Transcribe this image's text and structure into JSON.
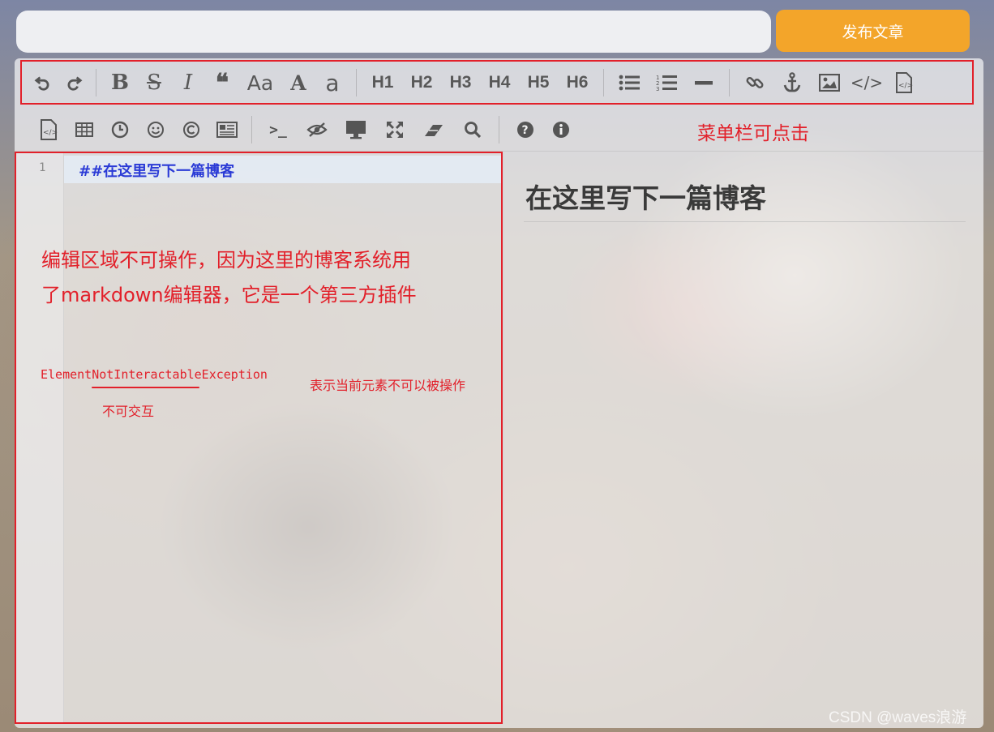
{
  "header": {
    "title_placeholder": "",
    "publish_label": "发布文章"
  },
  "toolbar_row1": [
    {
      "name": "undo-icon"
    },
    {
      "name": "redo-icon"
    },
    {
      "name": "bold-icon",
      "glyph": "B"
    },
    {
      "name": "strikethrough-icon",
      "glyph": "S"
    },
    {
      "name": "italic-icon",
      "glyph": "I"
    },
    {
      "name": "quote-icon",
      "glyph": "❝"
    },
    {
      "name": "uppercase-icon",
      "glyph": "Aa"
    },
    {
      "name": "ucfirst-icon",
      "glyph": "A"
    },
    {
      "name": "lowercase-icon",
      "glyph": "a"
    },
    {
      "name": "h1-button",
      "glyph": "H1"
    },
    {
      "name": "h2-button",
      "glyph": "H2"
    },
    {
      "name": "h3-button",
      "glyph": "H3"
    },
    {
      "name": "h4-button",
      "glyph": "H4"
    },
    {
      "name": "h5-button",
      "glyph": "H5"
    },
    {
      "name": "h6-button",
      "glyph": "H6"
    },
    {
      "name": "unordered-list-icon"
    },
    {
      "name": "ordered-list-icon"
    },
    {
      "name": "horizontal-rule-icon"
    },
    {
      "name": "link-icon"
    },
    {
      "name": "anchor-icon"
    },
    {
      "name": "image-icon"
    },
    {
      "name": "code-icon"
    },
    {
      "name": "code-block-icon"
    }
  ],
  "toolbar_row2": [
    {
      "name": "preformatted-text-icon"
    },
    {
      "name": "table-icon"
    },
    {
      "name": "datetime-icon"
    },
    {
      "name": "emoji-icon"
    },
    {
      "name": "html-entities-icon"
    },
    {
      "name": "pagebreak-icon"
    },
    {
      "name": "terminal-icon"
    },
    {
      "name": "watch-toggle-icon"
    },
    {
      "name": "preview-icon"
    },
    {
      "name": "fullscreen-icon"
    },
    {
      "name": "clear-icon"
    },
    {
      "name": "search-icon"
    },
    {
      "name": "help-icon"
    },
    {
      "name": "info-icon"
    }
  ],
  "editor": {
    "line_number": "1",
    "code_text": "##在这里写下一篇博客"
  },
  "preview": {
    "heading": "在这里写下一篇博客"
  },
  "annotations": {
    "menu_clickable": "菜单栏可点击",
    "editor_line1": "编辑区域不可操作，因为这里的博客系统用",
    "editor_line2": "了markdown编辑器，它是一个第三方插件",
    "exception": "ElementNotInteractableException",
    "not_interactive": "不可交互",
    "description": "表示当前元素不可以被操作"
  },
  "watermark": "CSDN @waves浪游",
  "colors": {
    "publish": "#f3a52a",
    "annotation_red": "#e2202a",
    "code_blue": "#2b3bd6"
  }
}
